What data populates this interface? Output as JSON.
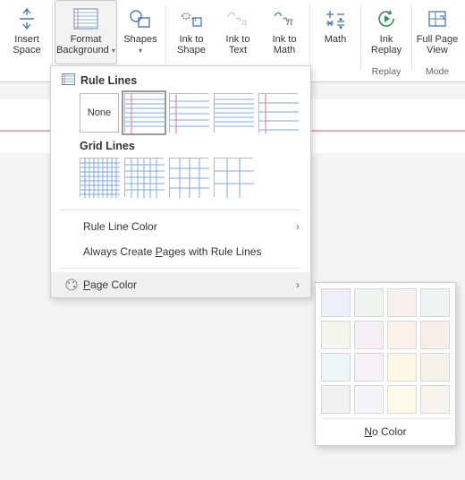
{
  "ribbon": {
    "insert_space": "Insert\nSpace",
    "format_background": "Format\nBackground",
    "shapes": "Shapes",
    "ink_to_shape": "Ink to\nShape",
    "ink_to_text": "Ink to\nText",
    "ink_to_math": "Ink to\nMath",
    "math": "Math",
    "ink_replay": "Ink\nReplay",
    "full_page_view": "Full Page\nView",
    "group_replay": "Replay",
    "group_mode": "Mode"
  },
  "dropdown": {
    "rule_lines_heading": "Rule Lines",
    "grid_lines_heading": "Grid Lines",
    "none_label": "None",
    "rule_line_color": "Rule Line Color",
    "always_create": "Always Create Pages with Rule Lines",
    "page_color": "Page Color",
    "rule_swatches": [
      "none",
      "narrow-blue",
      "narrow-red",
      "wide-blue",
      "wide-red"
    ],
    "grid_swatches": [
      "small",
      "medium",
      "large",
      "xlarge"
    ]
  },
  "flyout": {
    "no_color": "No Color",
    "colors": [
      "#eceef8",
      "#eef4ee",
      "#f7eeee",
      "#eef4f3",
      "#f3f6ed",
      "#f6eef5",
      "#fdf2ec",
      "#f5eee9",
      "#edf5f8",
      "#f7f0f7",
      "#fdf7e8",
      "#f4f0ea",
      "#f0f0f0",
      "#f7f3fa",
      "#fdfae9",
      "#f7f3ed"
    ]
  }
}
